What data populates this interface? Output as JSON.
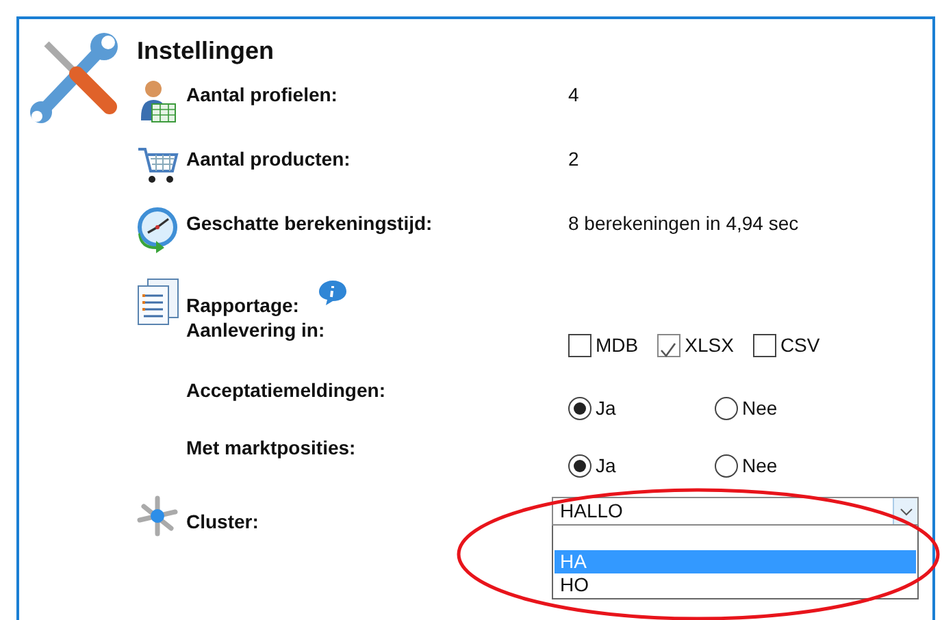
{
  "panel": {
    "title": "Instellingen"
  },
  "rows": [
    {
      "kind": "value",
      "label": "Aantal profielen:",
      "value": "4"
    },
    {
      "kind": "value",
      "label": "Aantal producten:",
      "value": "2"
    },
    {
      "kind": "value",
      "label": "Geschatte berekeningstijd:",
      "value": "8 berekeningen in 4,94 sec"
    },
    {
      "kind": "heading",
      "label": "Rapportage:"
    },
    {
      "kind": "checkboxes",
      "label": "Aanlevering in:",
      "options": [
        {
          "label": "MDB",
          "checked": false
        },
        {
          "label": "XLSX",
          "checked": true
        },
        {
          "label": "CSV",
          "checked": false
        }
      ]
    },
    {
      "kind": "radios",
      "label": "Acceptatiemeldingen:",
      "options": [
        {
          "label": "Ja",
          "selected": true
        },
        {
          "label": "Nee",
          "selected": false
        }
      ]
    },
    {
      "kind": "radios",
      "label": "Met marktposities:",
      "options": [
        {
          "label": "Ja",
          "selected": true
        },
        {
          "label": "Nee",
          "selected": false
        }
      ]
    },
    {
      "kind": "select",
      "label": "Cluster:",
      "value": "HALLO",
      "expanded": true,
      "blank_first_option": true,
      "options": [
        {
          "label": "HA",
          "selected": true
        },
        {
          "label": "HO",
          "selected": false
        }
      ]
    }
  ]
}
